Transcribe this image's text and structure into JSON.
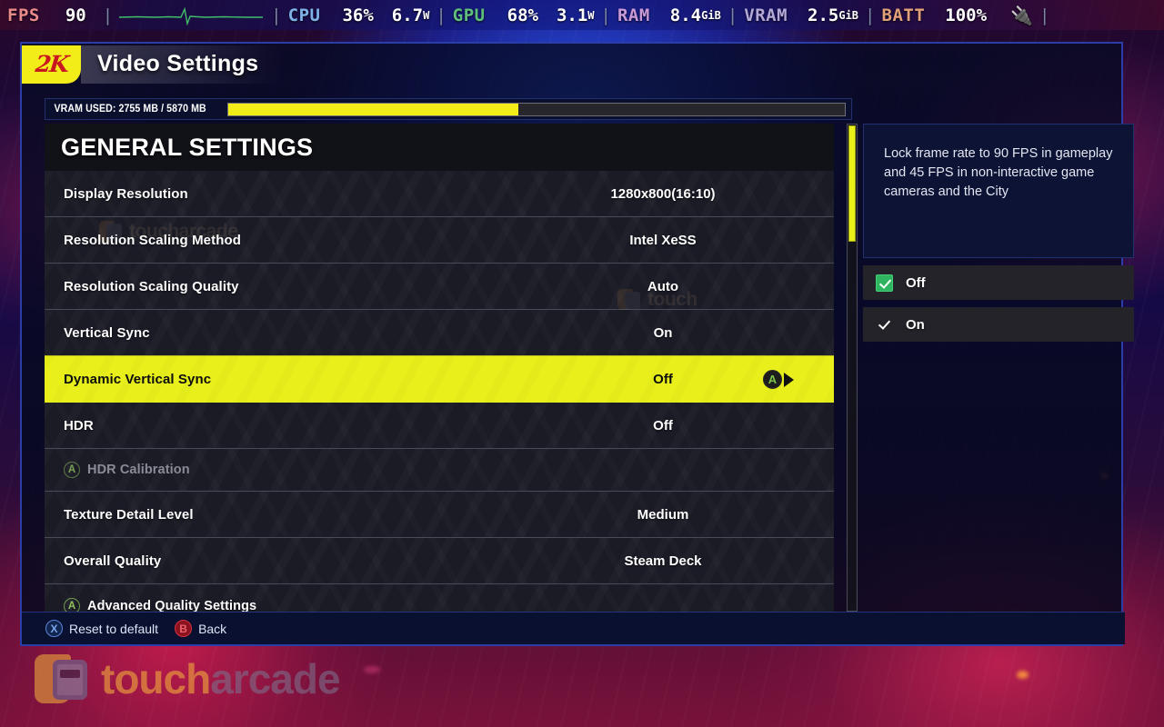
{
  "perf_overlay": {
    "fps": {
      "label": "FPS",
      "value": "90",
      "graph_icon": "fps-line-graph"
    },
    "cpu": {
      "label": "CPU",
      "usage": "36%",
      "power": "6.7",
      "power_unit": "W"
    },
    "gpu": {
      "label": "GPU",
      "usage": "68%",
      "power": "3.1",
      "power_unit": "W"
    },
    "ram": {
      "label": "RAM",
      "value": "8.4",
      "unit": "GiB"
    },
    "vram": {
      "label": "VRAM",
      "value": "2.5",
      "unit": "GiB"
    },
    "battery": {
      "label": "BATT",
      "value": "100%",
      "icon": "power-plug-icon"
    }
  },
  "header": {
    "brand_logo": "2k-logo",
    "brand_text": "2K",
    "title": "Video Settings"
  },
  "vram_meter": {
    "label": "VRAM USED: 2755 MB / 5870 MB",
    "used_mb": 2755,
    "total_mb": 5870,
    "fill_percent": 47,
    "fill_color": "#f2ed18"
  },
  "section": {
    "title": "GENERAL SETTINGS",
    "rows": [
      {
        "label": "Display Resolution",
        "value": "1280x800(16:10)",
        "type": "option",
        "selected": false
      },
      {
        "label": "Resolution Scaling Method",
        "value": "Intel XeSS",
        "type": "option",
        "selected": false
      },
      {
        "label": "Resolution Scaling Quality",
        "value": "Auto",
        "type": "option",
        "selected": false
      },
      {
        "label": "Vertical Sync",
        "value": "On",
        "type": "option",
        "selected": false
      },
      {
        "label": "Dynamic Vertical Sync",
        "value": "Off",
        "type": "option",
        "selected": true,
        "action_button": "A",
        "action_caret": "right-caret-icon"
      },
      {
        "label": "HDR",
        "value": "Off",
        "type": "option",
        "selected": false
      },
      {
        "label": "HDR Calibration",
        "value": "",
        "type": "action",
        "button": "A",
        "disabled": true
      },
      {
        "label": "Texture Detail Level",
        "value": "Medium",
        "type": "option",
        "selected": false
      },
      {
        "label": "Overall Quality",
        "value": "Steam Deck",
        "type": "option",
        "selected": false
      },
      {
        "label": "Advanced Quality Settings",
        "value": "",
        "type": "action",
        "button": "A",
        "disabled": false
      }
    ]
  },
  "detail": {
    "description": "Lock frame rate to 90 FPS in gameplay and 45 FPS in non-interactive game cameras and the City",
    "options": [
      {
        "label": "Off",
        "checked": true
      },
      {
        "label": "On",
        "checked": false
      }
    ]
  },
  "footer": {
    "hints": [
      {
        "button": "X",
        "label": "Reset to default"
      },
      {
        "button": "B",
        "label": "Back"
      }
    ]
  },
  "watermark": {
    "text_a": "touch",
    "text_b": "arcade"
  },
  "colors": {
    "accent_yellow": "#e8ef1a",
    "brand_yellow": "#f2ed18",
    "brand_red": "#c9181f",
    "check_green": "#2fb560",
    "panel_dark": "#14141c"
  }
}
